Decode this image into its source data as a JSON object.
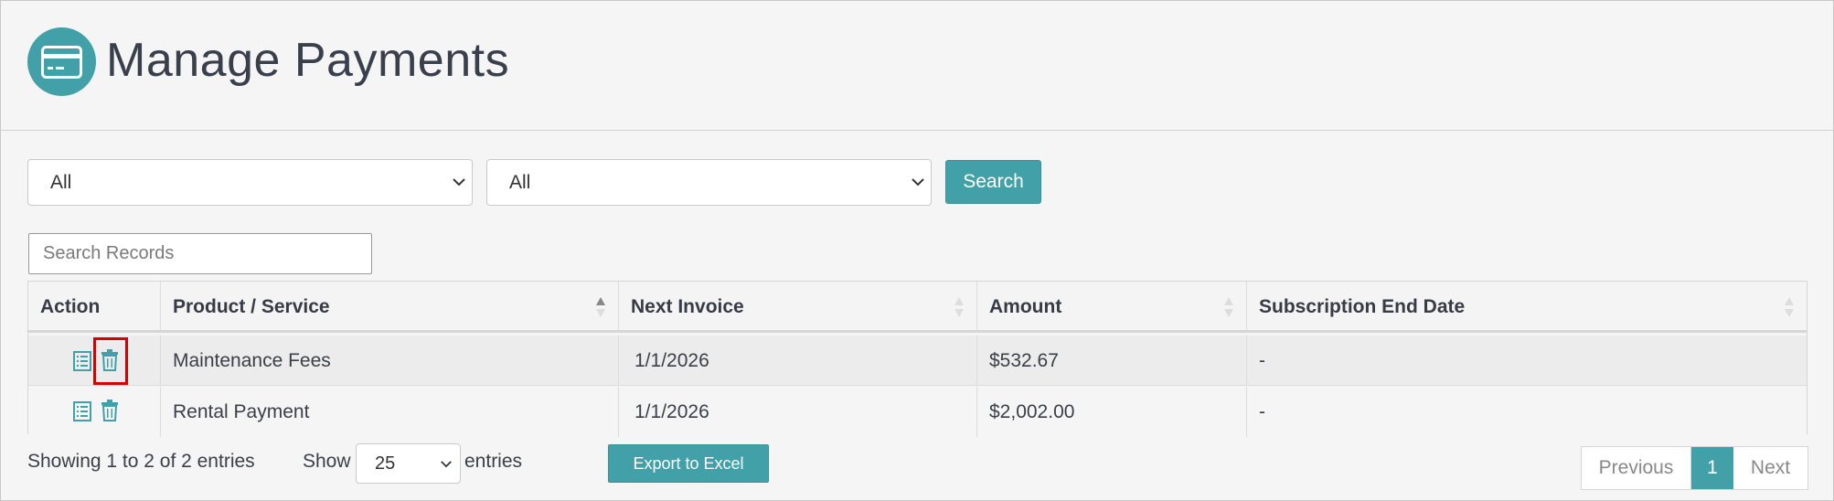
{
  "header": {
    "title": "Manage Payments",
    "icon": "credit-card-icon"
  },
  "filters": {
    "select1_value": "All",
    "select2_value": "All",
    "search_button": "Search"
  },
  "search": {
    "placeholder": "Search Records"
  },
  "table": {
    "columns": [
      "Action",
      "Product / Service",
      "Next Invoice",
      "Amount",
      "Subscription End Date"
    ],
    "rows": [
      {
        "product": "Maintenance Fees",
        "next_invoice": "1/1/2026",
        "amount": "$532.67",
        "end_date": "-"
      },
      {
        "product": "Rental Payment",
        "next_invoice": "1/1/2026",
        "amount": "$2,002.00",
        "end_date": "-"
      }
    ]
  },
  "footer": {
    "showing": "Showing 1 to 2 of 2 entries",
    "show_label": "Show",
    "page_size": "25",
    "entries_label": "entries",
    "export_button": "Export to Excel"
  },
  "pagination": {
    "previous": "Previous",
    "current": "1",
    "next": "Next"
  },
  "colors": {
    "accent": "#42a1a8",
    "highlight": "#d60000"
  }
}
